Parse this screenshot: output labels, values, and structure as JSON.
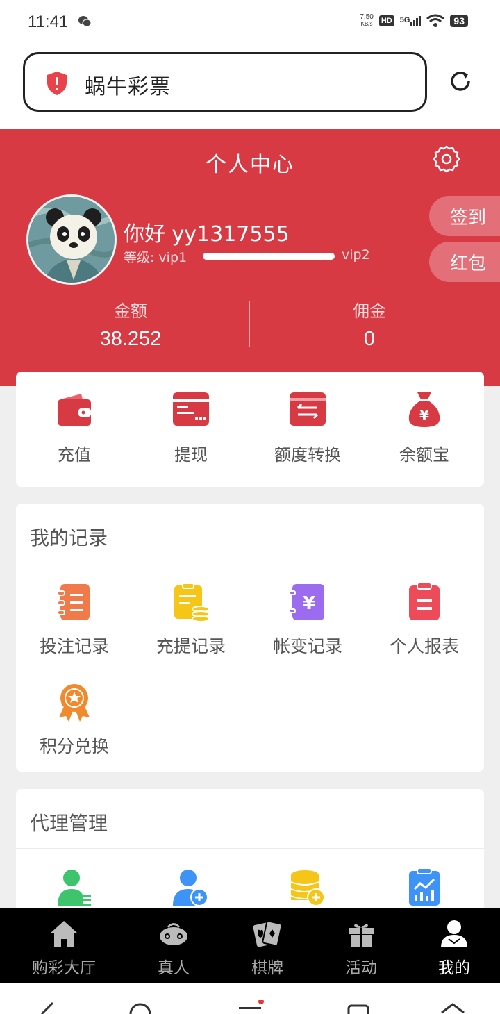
{
  "status_bar": {
    "time": "11:41",
    "speed_top": "7.50",
    "speed_bottom": "KB/s",
    "hd": "HD",
    "network": "5G",
    "battery": "93"
  },
  "browser": {
    "url_title": "蜗牛彩票"
  },
  "header": {
    "title": "个人中心",
    "greeting": "你好 yy1317555",
    "level_label": "等级: vip1",
    "level_next": "vip2",
    "level_progress": 1.0,
    "checkin": "签到",
    "red_packet": "红包",
    "balance_label": "金额",
    "balance_value": "38.252",
    "commission_label": "佣金",
    "commission_value": "0"
  },
  "quick_actions": [
    {
      "label": "充值",
      "icon": "wallet-icon",
      "color": "#d83a44"
    },
    {
      "label": "提现",
      "icon": "card-icon",
      "color": "#d83a44"
    },
    {
      "label": "额度转换",
      "icon": "transfer-icon",
      "color": "#d83a44"
    },
    {
      "label": "余额宝",
      "icon": "money-bag-icon",
      "color": "#d83a44"
    }
  ],
  "records": {
    "title": "我的记录",
    "items": [
      {
        "label": "投注记录",
        "icon": "bet-record-icon",
        "color": "#f07a4a"
      },
      {
        "label": "充提记录",
        "icon": "deposit-record-icon",
        "color": "#f5c518"
      },
      {
        "label": "帐变记录",
        "icon": "account-change-icon",
        "color": "#9b6bf0"
      },
      {
        "label": "个人报表",
        "icon": "report-icon",
        "color": "#ee4b5a"
      },
      {
        "label": "积分兑换",
        "icon": "medal-icon",
        "color": "#f08a2c"
      }
    ]
  },
  "agent": {
    "title": "代理管理",
    "items": [
      {
        "icon": "agent-user-list-icon",
        "color": "#3ec46d"
      },
      {
        "icon": "add-user-icon",
        "color": "#3d94f6"
      },
      {
        "icon": "coins-icon",
        "color": "#f5c518"
      },
      {
        "icon": "chart-report-icon",
        "color": "#3d94f6"
      }
    ]
  },
  "tabs": [
    {
      "label": "购彩大厅",
      "icon": "home-icon"
    },
    {
      "label": "真人",
      "icon": "gamepad-icon"
    },
    {
      "label": "棋牌",
      "icon": "cards-icon"
    },
    {
      "label": "活动",
      "icon": "gift-icon"
    },
    {
      "label": "我的",
      "icon": "user-icon",
      "active": true
    }
  ]
}
